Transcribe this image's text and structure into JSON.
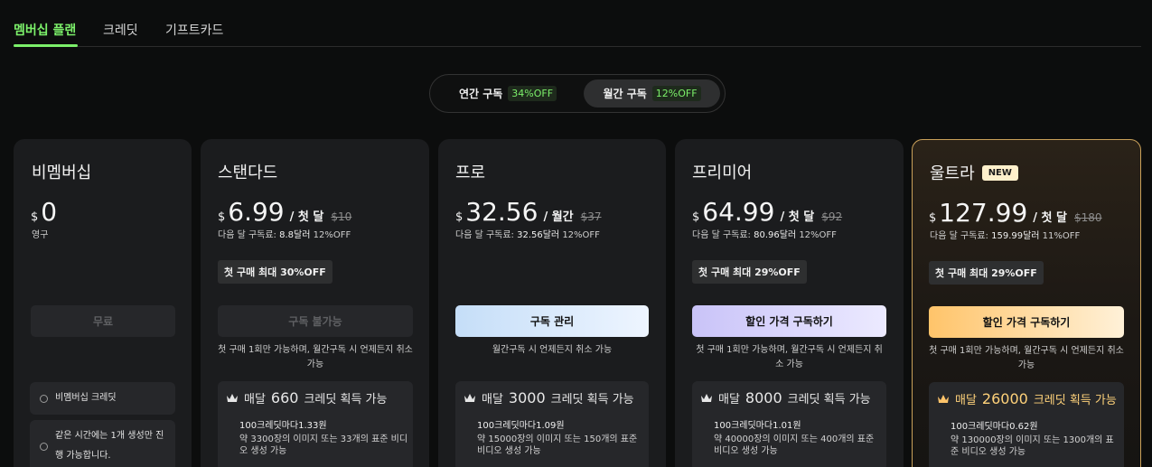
{
  "tabs": [
    {
      "label": "멤버십 플랜"
    },
    {
      "label": "크레딧"
    },
    {
      "label": "기프트카드"
    }
  ],
  "billing_toggle": {
    "yearly": {
      "label": "연간 구독",
      "badge": "34%OFF"
    },
    "monthly": {
      "label": "월간 구독",
      "badge": "12%OFF"
    },
    "selected": "monthly"
  },
  "colors": {
    "accent_green": "#7cf06a",
    "ultra_border": "#caa15a"
  },
  "plans": [
    {
      "name": "비멤버십",
      "currency": "$",
      "price": "0",
      "period_note": "영구",
      "cta": "무료",
      "features": [
        "비멤버십 크레딧",
        "같은 시간에는 1개 생성만 진행 가능합니다."
      ]
    },
    {
      "name": "스탠다드",
      "currency": "$",
      "price": "6.99",
      "period": "/ 첫 달",
      "original_price": "$10",
      "next_note_prefix": "다음 달 구독료: ",
      "next_price": "8.8달러",
      "next_off": " 12%OFF",
      "promo": "첫 구매 최대 30%OFF",
      "cta": "구독 불가능",
      "cta_note": "첫 구매 1회만 가능하며, 월간구독 시 언제든지 취소 가능",
      "credits_prefix": "매달",
      "credits": "660",
      "credits_suffix": "크레딧 획득 가능",
      "rate_prefix": "100크레딧마다",
      "rate": "1.33원",
      "detail": "약 3300장의 이미지 또는 33개의 표준 비디오 생성 가능"
    },
    {
      "name": "프로",
      "currency": "$",
      "price": "32.56",
      "period": "/ 월간",
      "original_price": "$37",
      "next_note_prefix": "다음 달 구독료: ",
      "next_price": "32.56달러",
      "next_off": " 12%OFF",
      "cta": "구독 관리",
      "cta_note": "월간구독 시 언제든지 취소 가능",
      "credits_prefix": "매달",
      "credits": "3000",
      "credits_suffix": "크레딧 획득 가능",
      "rate_prefix": "100크레딧마다",
      "rate": "1.09원",
      "detail": "약 15000장의 이미지 또는 150개의 표준 비디오 생성 가능"
    },
    {
      "name": "프리미어",
      "currency": "$",
      "price": "64.99",
      "period": "/ 첫 달",
      "original_price": "$92",
      "next_note_prefix": "다음 달 구독료: ",
      "next_price": "80.96달러",
      "next_off": " 12%OFF",
      "promo": "첫 구매 최대 29%OFF",
      "cta": "할인 가격 구독하기",
      "cta_note": "첫 구매 1회만 가능하며, 월간구독 시 언제든지 취소 가능",
      "credits_prefix": "매달",
      "credits": "8000",
      "credits_suffix": "크레딧 획득 가능",
      "rate_prefix": "100크레딧마다",
      "rate": "1.01원",
      "detail": "약 40000장의 이미지 또는 400개의 표준 비디오 생성 가능"
    },
    {
      "name": "울트라",
      "badge": "NEW",
      "currency": "$",
      "price": "127.99",
      "period": "/ 첫 달",
      "original_price": "$180",
      "next_note_prefix": "다음 달 구독료: ",
      "next_price": "159.99달러",
      "next_off": " 11%OFF",
      "promo": "첫 구매 최대 29%OFF",
      "cta": "할인 가격 구독하기",
      "cta_note": "첫 구매 1회만 가능하며, 월간구독 시 언제든지 취소 가능",
      "credits_prefix": "매달",
      "credits": "26000",
      "credits_suffix": "크레딧 획득 가능",
      "rate_prefix": "100크레딧마다",
      "rate": "0.62원",
      "detail": "약 130000장의 이미지 또는 1300개의 표준 비디오 생성 가능"
    }
  ]
}
